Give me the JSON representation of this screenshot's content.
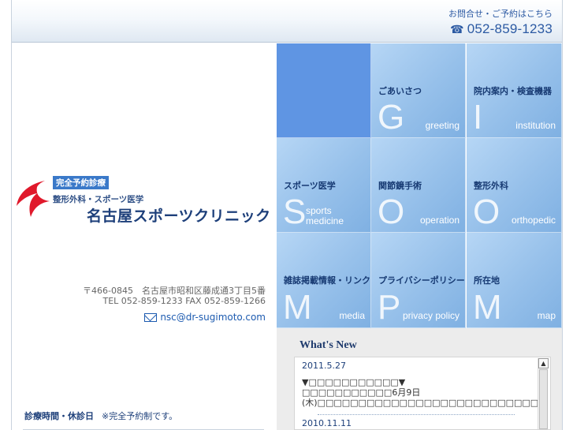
{
  "header": {
    "contact_caption": "お問合せ・ご予約はこちら",
    "phone": "052-859-1233",
    "phone_icon": "telephone-icon"
  },
  "clinic": {
    "badge": "完全予約診療",
    "subtitle": "整形外科・スポーツ医学",
    "name": "名古屋スポーツクリニック",
    "address": "〒466-0845　名古屋市昭和区藤成通3丁目5番",
    "tel_fax": "TEL 052-859-1233  FAX 052-859-1266",
    "email": "nsc@dr-sugimoto.com",
    "hours_title": "診療時間・休診日",
    "hours_note": "※完全予約制です。",
    "logo_color": "#e0192b"
  },
  "menu": [
    {
      "label": "",
      "letter": "",
      "english": ""
    },
    {
      "label": "ごあいさつ",
      "letter": "G",
      "english": "greeting"
    },
    {
      "label": "院内案内・検査機器",
      "letter": "I",
      "english": "institution"
    },
    {
      "label": "スポーツ医学",
      "letter": "S",
      "english": "sports medicine",
      "en_line1": "sports",
      "en_line2": "medicine"
    },
    {
      "label": "関節鏡手術",
      "letter": "O",
      "english": "operation"
    },
    {
      "label": "整形外科",
      "letter": "O",
      "english": "orthopedic"
    },
    {
      "label": "雑誌掲載情報・リンク",
      "letter": "M",
      "english": "media"
    },
    {
      "label": "プライバシーポリシー",
      "letter": "P",
      "english": "privacy policy"
    },
    {
      "label": "所在地",
      "letter": "M",
      "english": "map"
    }
  ],
  "news": {
    "title": "What's New",
    "items": [
      {
        "date": "2011.5.27",
        "headline": "▼□□□□□□□□□□□▼",
        "body": "□□□□□□□□□□□6月9日(木)□□□□□□□□□□□□□□□□□□□□□□□□□□□□"
      },
      {
        "date": "2010.11.11"
      }
    ]
  },
  "colors": {
    "accent": "#2c5aa3",
    "tile_solid": "#5f95e3",
    "tile_light": "#b6d6f5"
  }
}
